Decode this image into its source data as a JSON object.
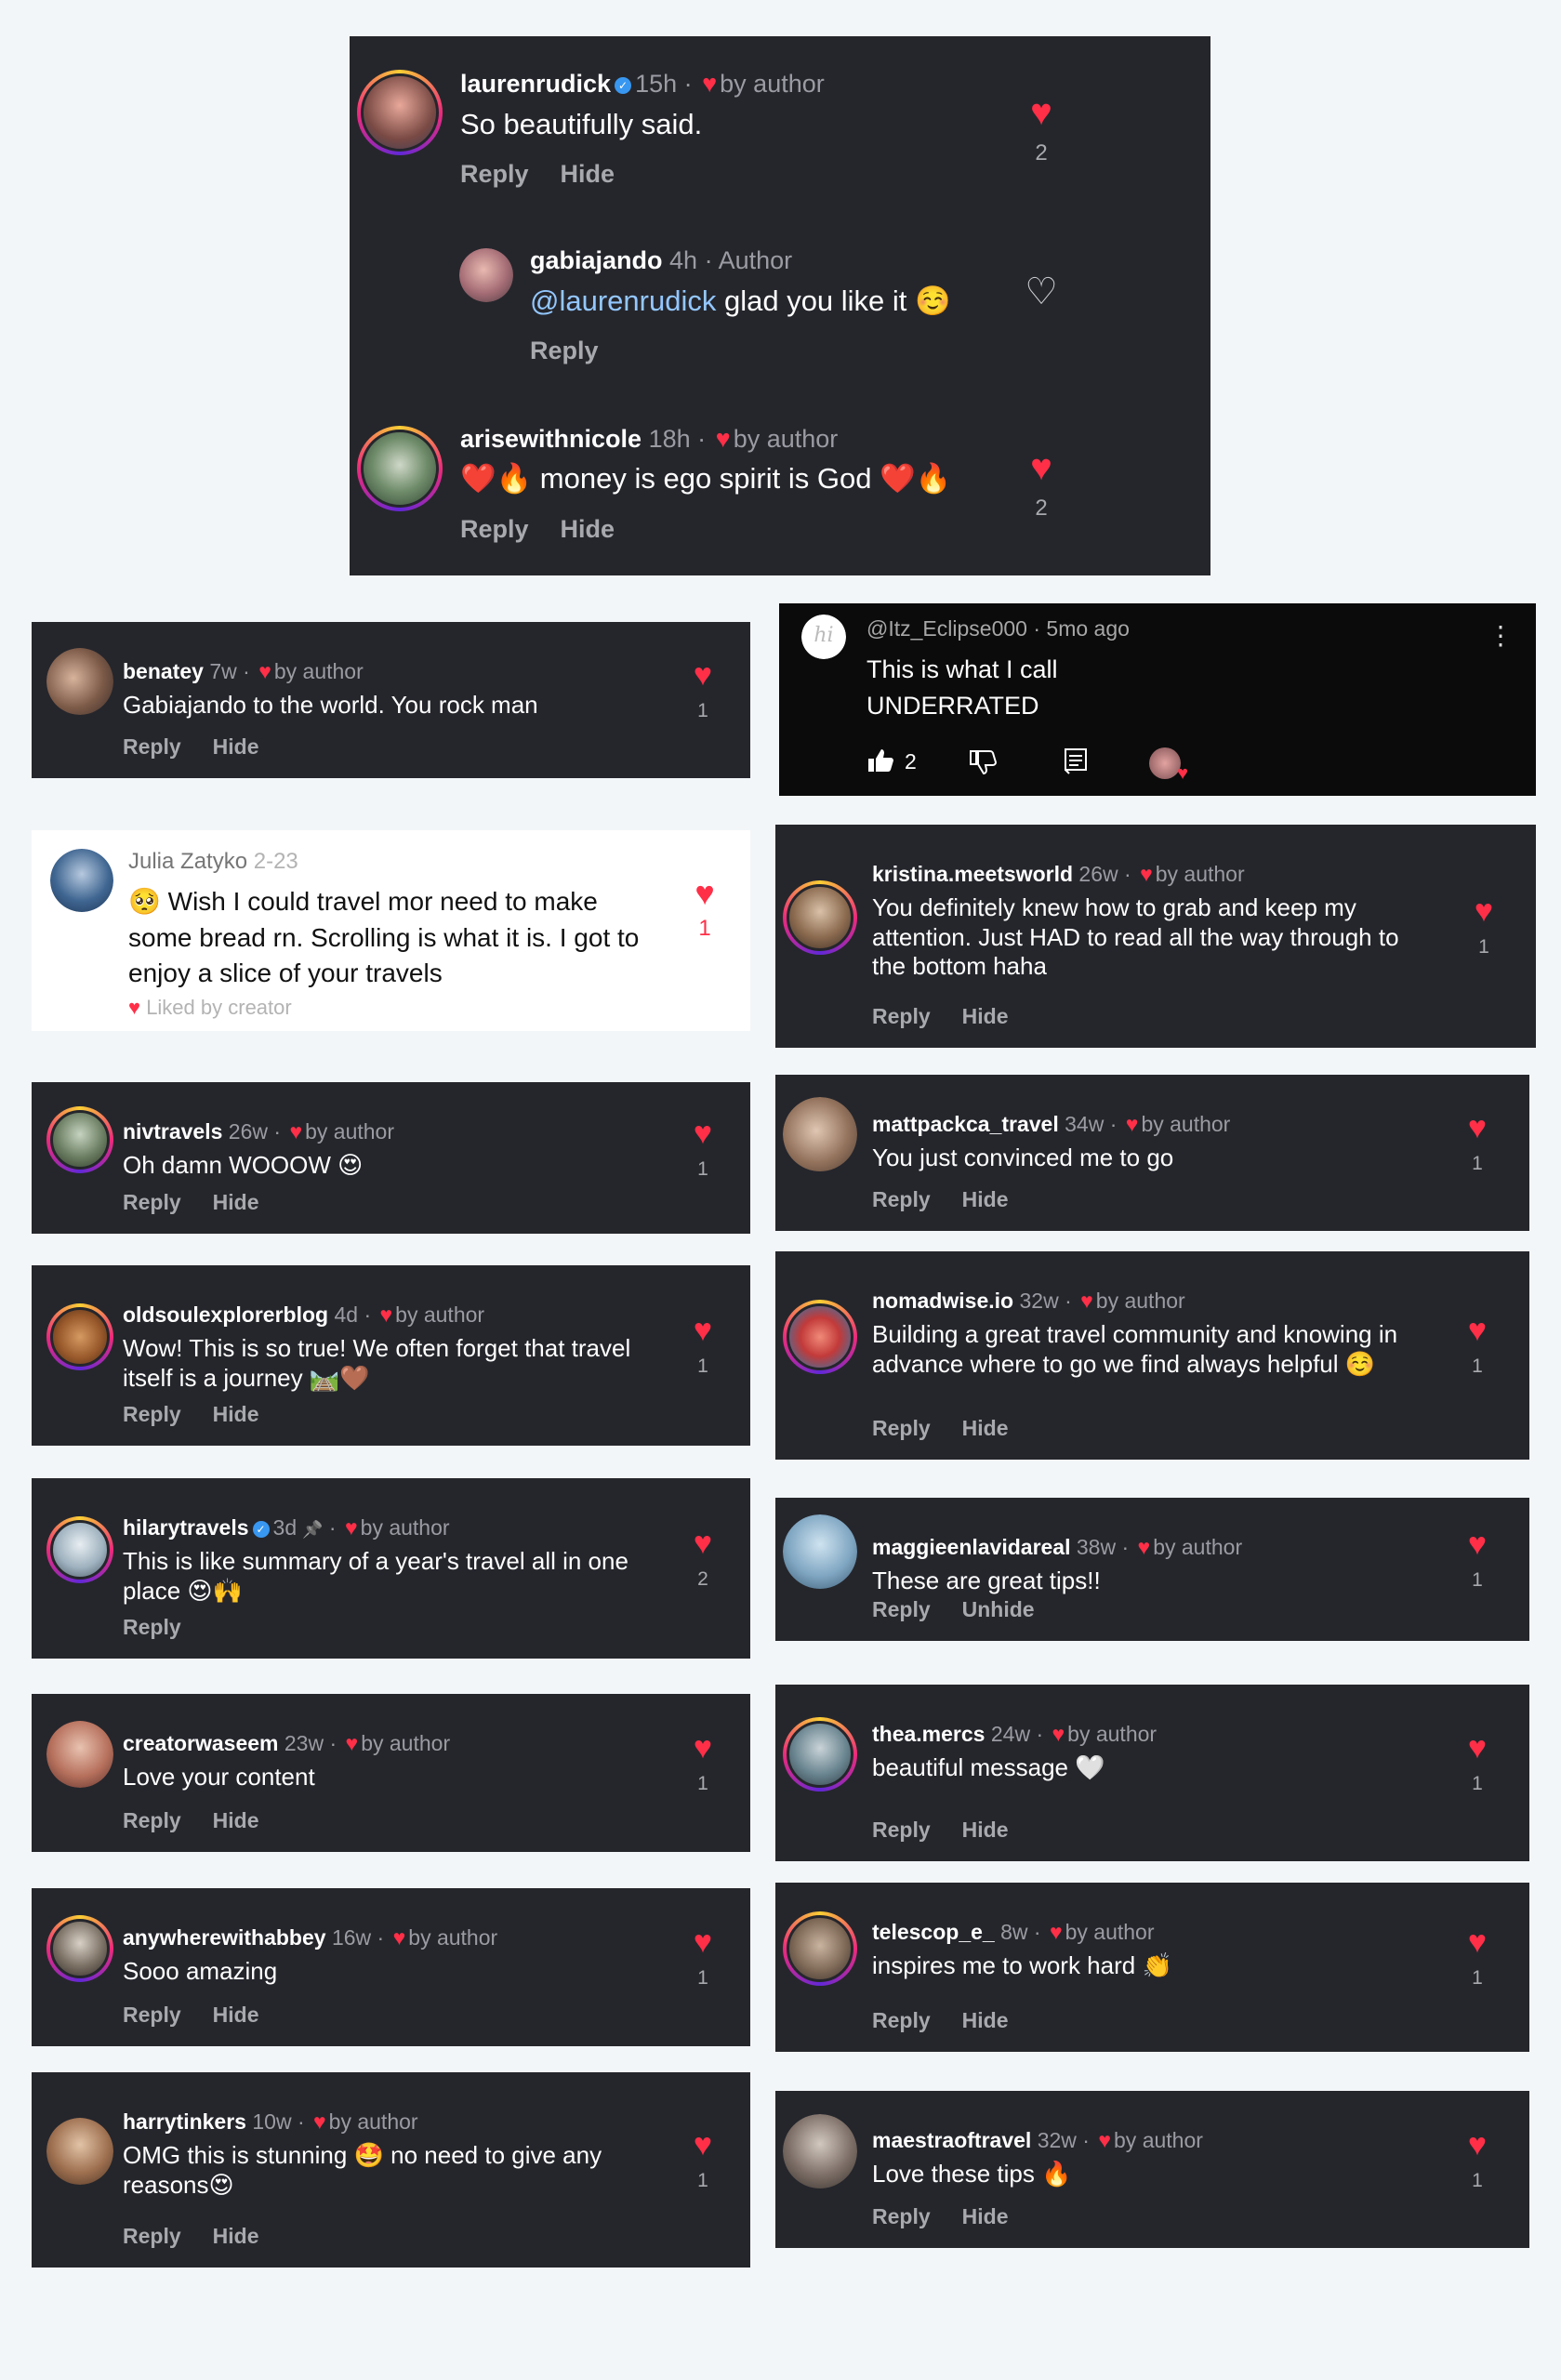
{
  "colors": {
    "card_bg": "#25262c",
    "heart": "#ff2f48",
    "muted": "#9b9ca3",
    "mention": "#93c7ff",
    "page_bg": "#f3f6f9"
  },
  "top": {
    "c1": {
      "username": "laurenrudick",
      "time": "15h",
      "tag": "by author",
      "text": "So beautifully said.",
      "reply": "Reply",
      "hide": "Hide",
      "likes": "2"
    },
    "c2": {
      "username": "gabiajando",
      "time": "4h",
      "tag": "Author",
      "mention": "@laurenrudick",
      "text": "glad you like it ☺️",
      "reply": "Reply"
    },
    "c3": {
      "username": "arisewithnicole",
      "time": "18h",
      "tag": "by author",
      "text": "❤️🔥 money is ego spirit is God ❤️🔥",
      "reply": "Reply",
      "hide": "Hide",
      "likes": "2"
    }
  },
  "yt": {
    "handle": "@Itz_Eclipse000",
    "time": "5mo ago",
    "line1": "This is what I call",
    "line2": "UNDERRATED",
    "likes": "2",
    "avatar_text": "hi"
  },
  "julia": {
    "username": "Julia Zatyko",
    "date": "2-23",
    "text": "🥺 Wish I could travel mor need to make some bread rn. Scrolling is what it is. I got to enjoy a slice of your travels",
    "liked_by": "Liked by creator",
    "likes": "1"
  },
  "comments": [
    {
      "username": "benatey",
      "time": "7w",
      "tag": "by author",
      "text": "Gabiajando to the world. You rock man",
      "reply": "Reply",
      "hide": "Hide",
      "likes": "1"
    },
    {
      "username": "kristina.meetsworld",
      "time": "26w",
      "tag": "by author",
      "text": "You definitely knew how to grab and keep my attention. Just HAD to read all the way through to the bottom haha",
      "reply": "Reply",
      "hide": "Hide",
      "likes": "1"
    },
    {
      "username": "nivtravels",
      "time": "26w",
      "tag": "by author",
      "text": "Oh damn WOOOW 😍",
      "reply": "Reply",
      "hide": "Hide",
      "likes": "1"
    },
    {
      "username": "mattpackca_travel",
      "time": "34w",
      "tag": "by author",
      "text": "You just convinced me to go",
      "reply": "Reply",
      "hide": "Hide",
      "likes": "1"
    },
    {
      "username": "oldsoulexplorerblog",
      "time": "4d",
      "tag": "by author",
      "text": "Wow! This is so true! We often forget that travel itself is a journey 🛤️🤎",
      "reply": "Reply",
      "hide": "Hide",
      "likes": "1"
    },
    {
      "username": "nomadwise.io",
      "time": "32w",
      "tag": "by author",
      "text": "Building a great travel community and knowing in advance where to go we find always helpful ☺️",
      "reply": "Reply",
      "hide": "Hide",
      "likes": "1"
    },
    {
      "username": "hilarytravels",
      "time": "3d",
      "pin": "📌",
      "tag": "by author",
      "text": "This is like summary of a year's travel all in one place 😍🙌",
      "reply": "Reply",
      "likes": "2"
    },
    {
      "username": "maggieenlavidareal",
      "time": "38w",
      "tag": "by author",
      "text": "These are great tips!!",
      "reply": "Reply",
      "hide": "Unhide",
      "likes": "1"
    },
    {
      "username": "creatorwaseem",
      "time": "23w",
      "tag": "by author",
      "text": "Love your content",
      "reply": "Reply",
      "hide": "Hide",
      "likes": "1"
    },
    {
      "username": "thea.mercs",
      "time": "24w",
      "tag": "by author",
      "text": "beautiful message 🤍",
      "reply": "Reply",
      "hide": "Hide",
      "likes": "1"
    },
    {
      "username": "anywherewithabbey",
      "time": "16w",
      "tag": "by author",
      "text": "Sooo amazing",
      "reply": "Reply",
      "hide": "Hide",
      "likes": "1"
    },
    {
      "username": "telescop_e_",
      "time": "8w",
      "tag": "by author",
      "text": "inspires me to work hard 👏",
      "reply": "Reply",
      "hide": "Hide",
      "likes": "1"
    },
    {
      "username": "harrytinkers",
      "time": "10w",
      "tag": "by author",
      "text": "OMG this is stunning 🤩 no need to give any reasons😍",
      "reply": "Reply",
      "hide": "Hide",
      "likes": "1"
    },
    {
      "username": "maestraoftravel",
      "time": "32w",
      "tag": "by author",
      "text": "Love these tips 🔥",
      "reply": "Reply",
      "hide": "Hide",
      "likes": "1"
    }
  ]
}
